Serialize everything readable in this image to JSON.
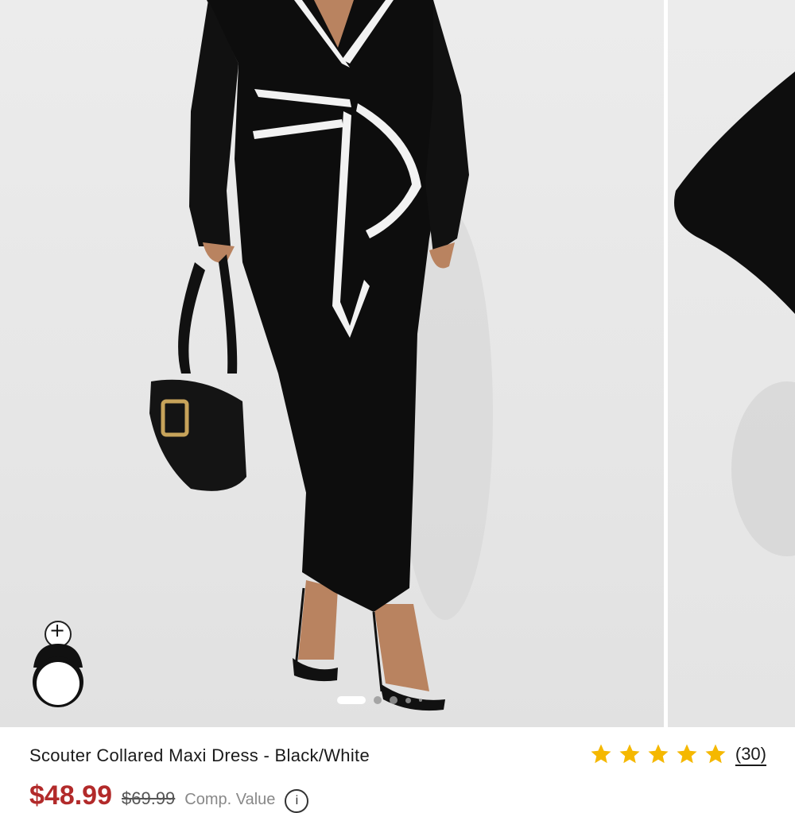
{
  "product": {
    "title": "Scouter Collared Maxi Dress - Black/White",
    "rating": {
      "stars": 5,
      "max_stars": 5,
      "review_count": "(30)",
      "star_color": "#f5b800"
    },
    "price": {
      "sale": "$48.99",
      "original": "$69.99",
      "note": "Comp. Value",
      "sale_color": "#b22a2a"
    }
  },
  "gallery": {
    "slide_count": 5,
    "active_slide": 1,
    "try_on_icon": "add-avatar-icon",
    "plus_glyph": "+"
  }
}
